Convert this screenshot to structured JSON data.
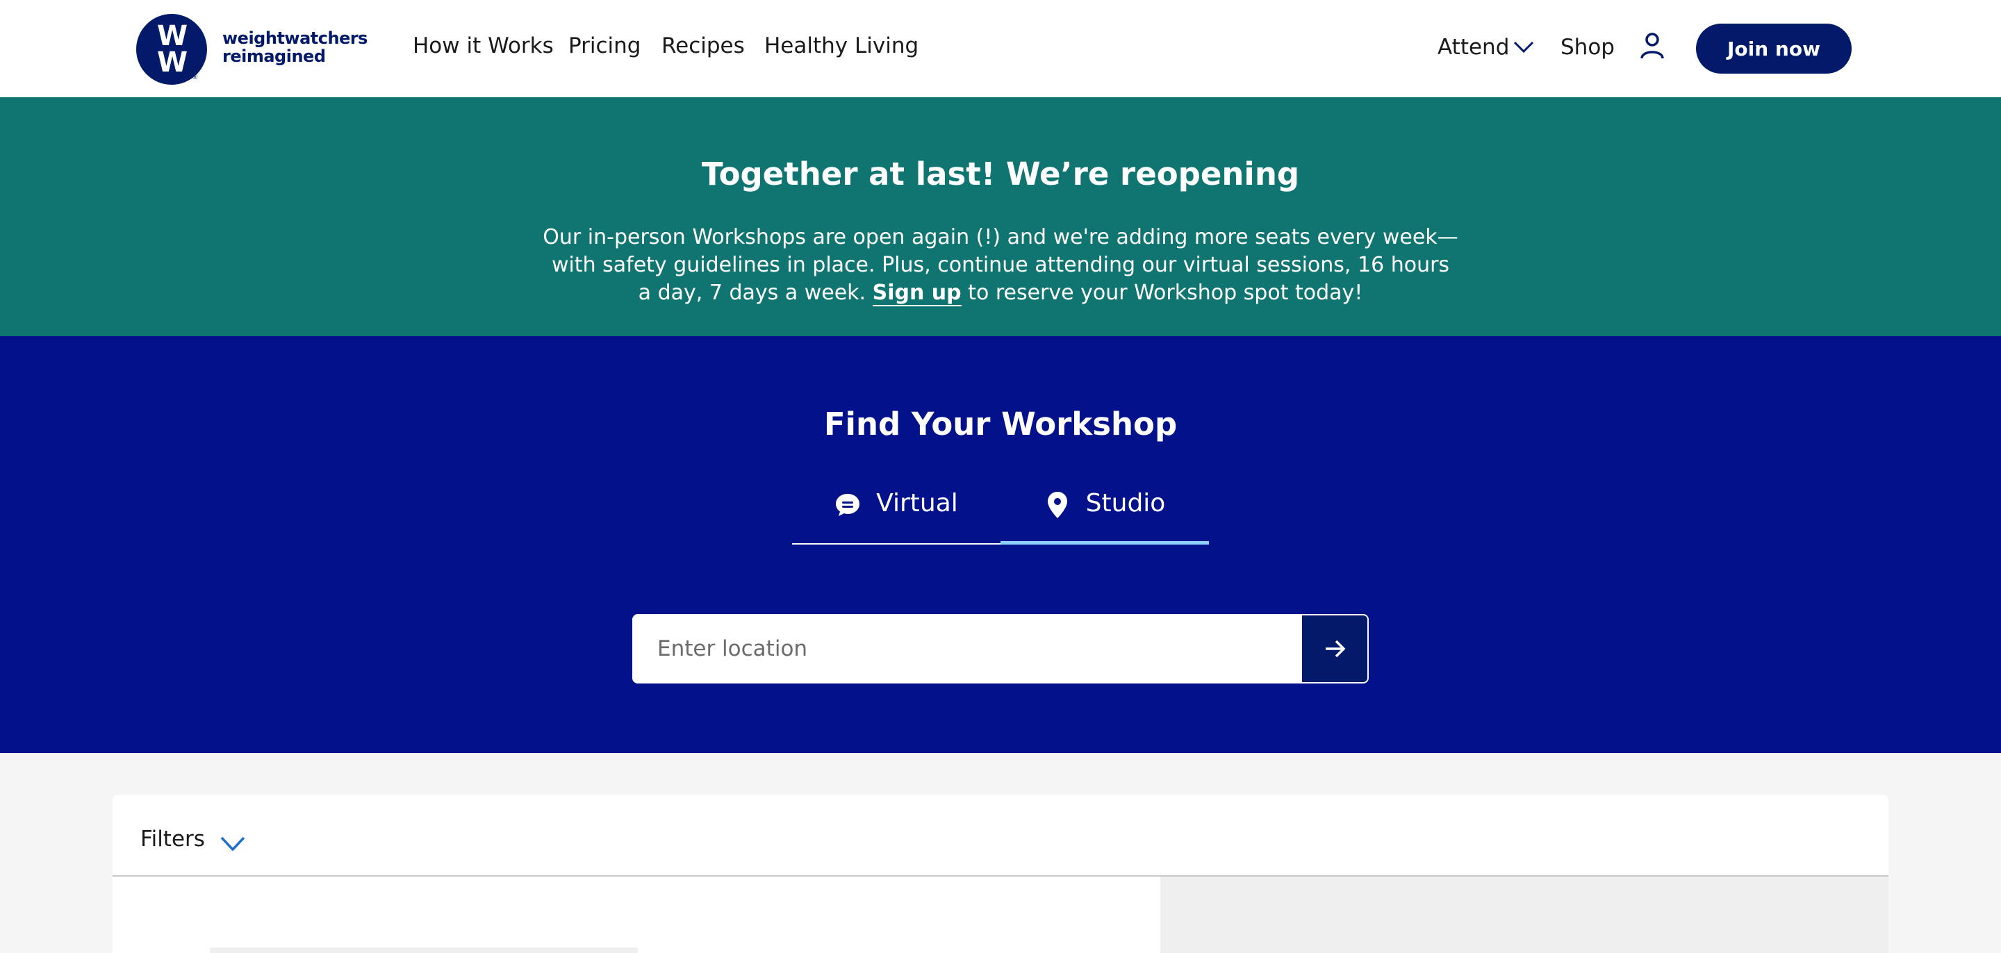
{
  "header": {
    "logo_mark": "WW",
    "logo_text_line1": "weightwatchers",
    "logo_text_line2": "reimagined",
    "nav": [
      "How it Works",
      "Pricing",
      "Recipes",
      "Healthy Living"
    ],
    "attend_label": "Attend",
    "shop_label": "Shop",
    "join_label": "Join now"
  },
  "banner": {
    "title": "Together at last! We’re reopening",
    "text_before": "Our in-person Workshops are open again (!) and we're adding more seats every week—with safety guidelines in place. Plus, continue attending our virtual sessions, 16 hours a day, 7 days a week. ",
    "link_label": "Sign up",
    "text_after": " to reserve your Workshop spot today!"
  },
  "finder": {
    "title": "Find Your Workshop",
    "tabs": [
      {
        "label": "Virtual",
        "icon": "chat-bubble-icon"
      },
      {
        "label": "Studio",
        "icon": "map-pin-icon",
        "selected": true
      }
    ],
    "search_placeholder": "Enter location",
    "search_value": ""
  },
  "filters": {
    "label": "Filters"
  },
  "colors": {
    "brand_navy": "#031a6b",
    "finder_blue": "#03128a",
    "banner_teal": "#107570",
    "tab_active": "#8fd2ff",
    "filter_chevron": "#1f6fd1"
  }
}
